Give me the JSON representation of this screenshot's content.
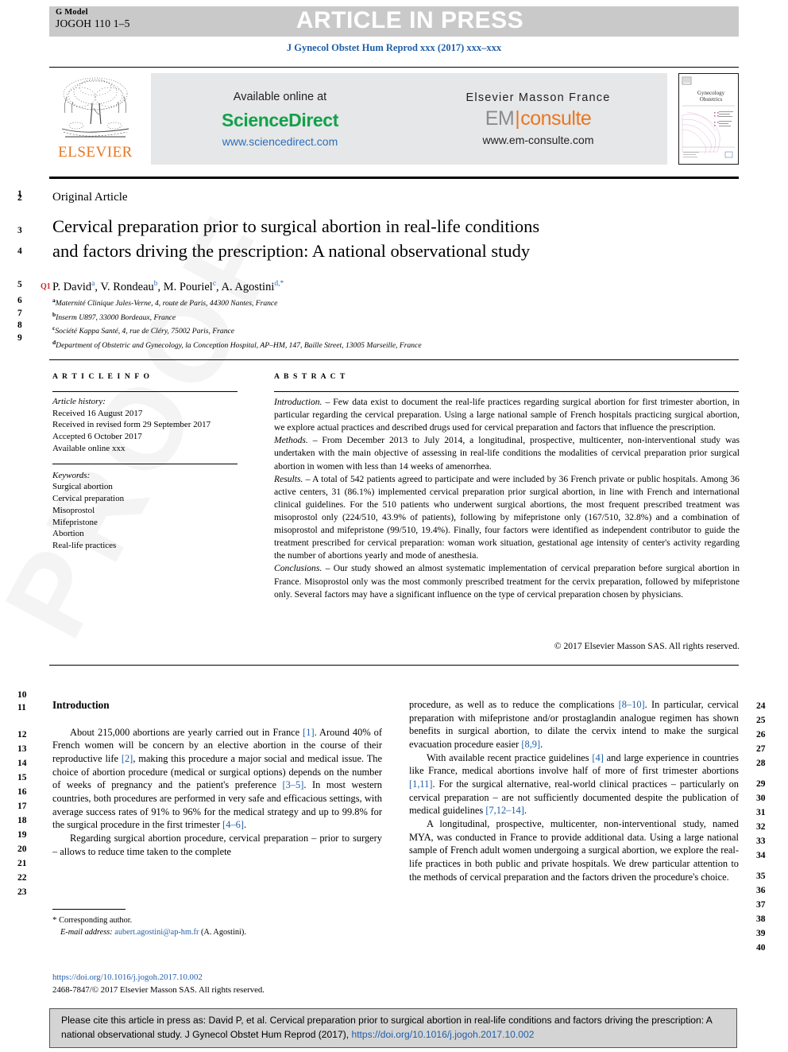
{
  "header": {
    "g_model_label": "G Model",
    "g_model_id": "JOGOH 110 1–5",
    "press_banner": "ARTICLE IN PRESS",
    "journal_line": "J Gynecol Obstet Hum Reprod xxx (2017) xxx–xxx",
    "banner_grey": "#c9c9c9",
    "journal_blue": "#1f5fa9"
  },
  "masthead": {
    "elsevier_wordmark": "ELSEVIER",
    "elsevier_orange": "#e87722",
    "available_online": "Available online at",
    "sciencedirect": "ScienceDirect",
    "sciencedirect_green": "#12a14b",
    "sciencedirect_url": "www.sciencedirect.com",
    "masson": "Elsevier Masson France",
    "em": "EM",
    "consulte": "consulte",
    "em_url": "www.em-consulte.com",
    "cover_title_1": "Gynecology",
    "cover_title_2": "Obstetrics"
  },
  "article": {
    "type": "Original Article",
    "query_marker": "Q1",
    "title_line1": "Cervical preparation prior to surgical abortion in real-life conditions",
    "title_line2": "and factors driving the prescription: A national observational study",
    "authors_plain": "P. David a, V. Rondeau b, M. Pouriel c, A. Agostini d,*",
    "authors": [
      {
        "name": "P. David",
        "sup": "a"
      },
      {
        "name": "V. Rondeau",
        "sup": "b"
      },
      {
        "name": "M. Pouriel",
        "sup": "c"
      },
      {
        "name": "A. Agostini",
        "sup": "d,*"
      }
    ],
    "affiliations": [
      {
        "mark": "a",
        "text": "Maternité Clinique Jules-Verne, 4, route de Paris, 44300 Nantes, France"
      },
      {
        "mark": "b",
        "text": "Inserm U897, 33000 Bordeaux, France"
      },
      {
        "mark": "c",
        "text": "Société Kappa Santé, 4, rue de Cléry, 75002 Paris, France"
      },
      {
        "mark": "d",
        "text": "Department of Obstetric and Gynecology, la Conception Hospital, AP–HM, 147, Baille Street, 13005 Marseille, France"
      }
    ]
  },
  "article_info": {
    "heading": "A R T I C L E  I N F O",
    "history_label": "Article history:",
    "history": [
      "Received 16 August 2017",
      "Received in revised form 29 September 2017",
      "Accepted 6 October 2017",
      "Available online xxx"
    ],
    "keywords_label": "Keywords:",
    "keywords": [
      "Surgical abortion",
      "Cervical preparation",
      "Misoprostol",
      "Mifepristone",
      "Abortion",
      "Real-life practices"
    ]
  },
  "abstract": {
    "heading": "A B S T R A C T",
    "sections": [
      {
        "label": "Introduction.",
        "dash": " – ",
        "text": "Few data exist to document the real-life practices regarding surgical abortion for first trimester abortion, in particular regarding the cervical preparation. Using a large national sample of French hospitals practicing surgical abortion, we explore actual practices and described drugs used for cervical preparation and factors that influence the prescription."
      },
      {
        "label": "Methods.",
        "dash": " – ",
        "text": "From December 2013 to July 2014, a longitudinal, prospective, multicenter, non-interventional study was undertaken with the main objective of assessing in real-life conditions the modalities of cervical preparation prior surgical abortion in women with less than 14 weeks of amenorrhea."
      },
      {
        "label": "Results.",
        "dash": " – ",
        "text": "A total of 542 patients agreed to participate and were included by 36 French private or public hospitals. Among 36 active centers, 31 (86.1%) implemented cervical preparation prior surgical abortion, in line with French and international clinical guidelines. For the 510 patients who underwent surgical abortions, the most frequent prescribed treatment was misoprostol only (224/510, 43.9% of patients), following by mifepristone only (167/510, 32.8%) and a combination of misoprostol and mifepristone (99/510, 19.4%). Finally, four factors were identified as independent contributor to guide the treatment prescribed for cervical preparation: woman work situation, gestational age intensity of center's activity regarding the number of abortions yearly and mode of anesthesia."
      },
      {
        "label": "Conclusions.",
        "dash": " – ",
        "text": "Our study showed an almost systematic implementation of cervical preparation before surgical abortion in France. Misoprostol only was the most commonly prescribed treatment for the cervix preparation, followed by mifepristone only. Several factors may have a significant influence on the type of cervical preparation chosen by physicians."
      }
    ],
    "copyright": "© 2017 Elsevier Masson SAS. All rights reserved."
  },
  "body": {
    "intro_heading": "Introduction",
    "left_paragraphs": [
      "About 215,000 abortions are yearly carried out in France [1]. Around 40% of French women will be concern by an elective abortion in the course of their reproductive life [2], making this procedure a major social and medical issue. The choice of abortion procedure (medical or surgical options) depends on the number of weeks of pregnancy and the patient's preference [3–5]. In most western countries, both procedures are performed in very safe and efficacious settings, with average success rates of 91% to 96% for the medical strategy and up to 99.8% for the surgical procedure in the first trimester [4–6].",
      "Regarding surgical abortion procedure, cervical preparation – prior to surgery – allows to reduce time taken to the complete"
    ],
    "right_paragraphs": [
      "procedure, as well as to reduce the complications [8–10]. In particular, cervical preparation with mifepristone and/or prostaglandin analogue regimen has shown benefits in surgical abortion, to dilate the cervix intend to make the surgical evacuation procedure easier [8,9].",
      "With available recent practice guidelines [4] and large experience in countries like France, medical abortions involve half of more of first trimester abortions [1,11]. For the surgical alternative, real-world clinical practices – particularly on cervical preparation – are not sufficiently documented despite the publication of medical guidelines [7,12–14].",
      "A longitudinal, prospective, multicenter, non-interventional study, named MYA, was conducted in France to provide additional data. Using a large national sample of French adult women undergoing a surgical abortion, we explore the real-life practices in both public and private hospitals. We drew particular attention to the methods of cervical preparation and the factors driven the procedure's choice."
    ]
  },
  "footnote": {
    "corresponding_marker": "*",
    "corresponding_label": "Corresponding author.",
    "email_label": "E-mail address:",
    "email": "aubert.agostini@ap-hm.fr",
    "email_suffix": "(A. Agostini).",
    "doi": "https://doi.org/10.1016/j.jogoh.2017.10.002",
    "issn_line": "2468-7847/© 2017 Elsevier Masson SAS. All rights reserved.",
    "link_blue": "#1f5fa9"
  },
  "cite_box": {
    "text_part1": "Please cite this article in press as: David P, et al. Cervical preparation prior to surgical abortion in real-life conditions and factors driving the prescription: A national observational study. J Gynecol Obstet Hum Reprod (2017), ",
    "doi_link": "https://doi.org/10.1016/j.jogoh.2017.10.002",
    "background": "#d4d4d4"
  },
  "line_numbers": {
    "left": [
      "1",
      "2",
      "3",
      "4",
      "5",
      "6",
      "7",
      "8",
      "9",
      "10",
      "11",
      "12",
      "13",
      "14",
      "15",
      "16",
      "17",
      "18",
      "19",
      "20",
      "21",
      "22",
      "23"
    ],
    "right": [
      "24",
      "25",
      "26",
      "27",
      "28",
      "29",
      "30",
      "31",
      "32",
      "33",
      "34",
      "35",
      "36",
      "37",
      "38",
      "39",
      "40"
    ]
  },
  "watermark": {
    "text": "PROOF"
  }
}
